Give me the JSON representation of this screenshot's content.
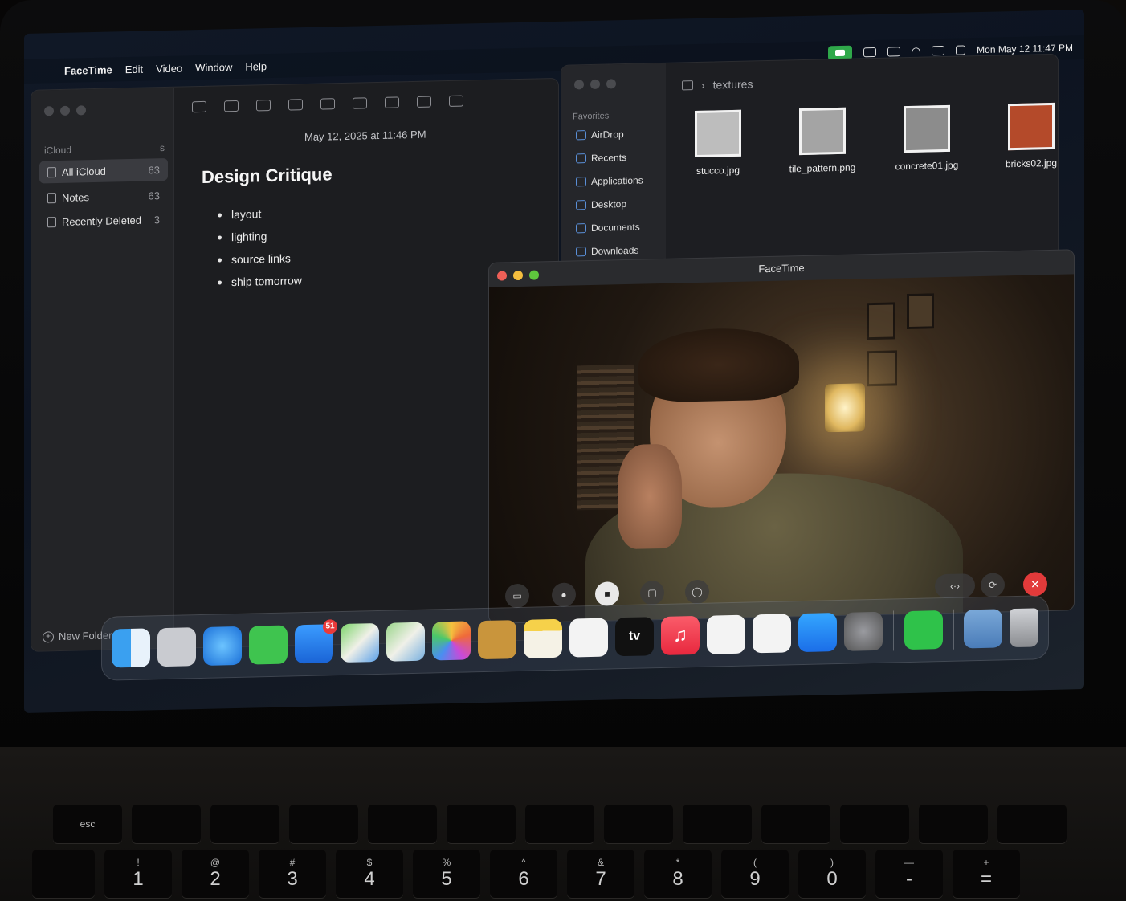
{
  "menubar": {
    "items": [
      "FaceTime",
      "Edit",
      "Video",
      "Window",
      "Help"
    ],
    "datetime": "Mon May 12  11:47 PM"
  },
  "notes": {
    "sidebar_header": "iCloud",
    "sidebar_header_badge": "s",
    "folders": [
      {
        "label": "All iCloud",
        "count": "63"
      },
      {
        "label": "Notes",
        "count": "63"
      },
      {
        "label": "Recently Deleted",
        "count": "3"
      }
    ],
    "new_folder": "New Folder",
    "date": "May 12, 2025 at 11:46 PM",
    "title": "Design Critique",
    "bullets": [
      "layout",
      "lighting",
      "source links",
      "ship tomorrow"
    ]
  },
  "finder": {
    "path": "textures",
    "favorites_header": "Favorites",
    "favorites": [
      "AirDrop",
      "Recents",
      "Applications",
      "Desktop",
      "Documents",
      "Downloads"
    ],
    "files": [
      {
        "name": "stucco.jpg",
        "color": "#bdbdbd"
      },
      {
        "name": "tile_pattern.png",
        "color": "#a4a4a4"
      },
      {
        "name": "concrete01.jpg",
        "color": "#8c8c8c"
      },
      {
        "name": "bricks02.jpg",
        "color": "#b44a2a"
      }
    ]
  },
  "facetime": {
    "title": "FaceTime",
    "controls": [
      "sidebar-icon",
      "microphone-icon",
      "video-icon",
      "share-screen-icon",
      "effects-icon",
      "audio-icon",
      "flip-camera-icon",
      "end-call-icon"
    ]
  },
  "dock": {
    "mail_badge": "51",
    "tv_label": "tv",
    "apps": [
      "Finder",
      "Launchpad",
      "Safari",
      "Messages",
      "Mail",
      "Maps",
      "Find My",
      "Photos",
      "Contacts",
      "Notes",
      "Reminders",
      "TV",
      "Music",
      "Freeform",
      "News",
      "App Store",
      "System Settings",
      "FaceTime",
      "Downloads",
      "Trash"
    ]
  },
  "keyboard": {
    "esc": "esc",
    "numbers": [
      {
        "top": "!",
        "main": "1"
      },
      {
        "top": "@",
        "main": "2"
      },
      {
        "top": "#",
        "main": "3"
      },
      {
        "top": "$",
        "main": "4"
      },
      {
        "top": "%",
        "main": "5"
      },
      {
        "top": "^",
        "main": "6"
      },
      {
        "top": "&",
        "main": "7"
      },
      {
        "top": "*",
        "main": "8"
      },
      {
        "top": "(",
        "main": "9"
      },
      {
        "top": ")",
        "main": "0"
      },
      {
        "top": "—",
        "main": "-"
      },
      {
        "top": "+",
        "main": "="
      }
    ]
  },
  "colors": {
    "traffic_close": "#ee5f57",
    "traffic_min": "#f4bd3e",
    "traffic_max": "#5fc73d",
    "facetime_green": "#2fa84a",
    "end_call_red": "#e23a3a"
  }
}
